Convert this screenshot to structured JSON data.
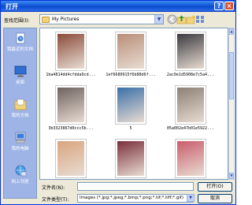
{
  "window": {
    "title": "打开"
  },
  "toolbar": {
    "look_in_label": "查找范围(I):",
    "look_in_value": "My Pictures"
  },
  "places": [
    {
      "label": "我最近的文档",
      "icon": "recent-documents-icon"
    },
    {
      "label": "桌面",
      "icon": "desktop-icon"
    },
    {
      "label": "我的文档",
      "icon": "my-documents-icon"
    },
    {
      "label": "我的电脑",
      "icon": "my-computer-icon"
    },
    {
      "label": "网上邻居",
      "icon": "network-places-icon"
    }
  ],
  "files": [
    {
      "name": "1ba4814dd4cfdda9cd...",
      "color": "#8a4b3b"
    },
    {
      "name": "1ef6680915f6b88d6f...",
      "color": "#b98e78"
    },
    {
      "name": "2ac0e1d5908e7c5a4...",
      "color": "#3a3a40"
    },
    {
      "name": "3b3323867d0ccc5b...",
      "color": "#6d625e"
    },
    {
      "name": "5",
      "color": "#3b6fa8"
    },
    {
      "name": "05a002e47b01e5922...",
      "color": "#8b7f76"
    },
    {
      "name": "",
      "color": "#d9a57f"
    },
    {
      "name": "",
      "color": "#7a2f3a"
    },
    {
      "name": "",
      "color": "#c95d6b"
    }
  ],
  "bottom": {
    "filename_label": "文件名(N):",
    "filename_value": "",
    "filetype_label": "文件类型(T):",
    "filetype_value": "Images (*.jpg;*.jpeg;*.bmp;*.png;*.tif;*.tiff;*.gif)",
    "open_label": "打开(O)",
    "cancel_label": "取消"
  }
}
